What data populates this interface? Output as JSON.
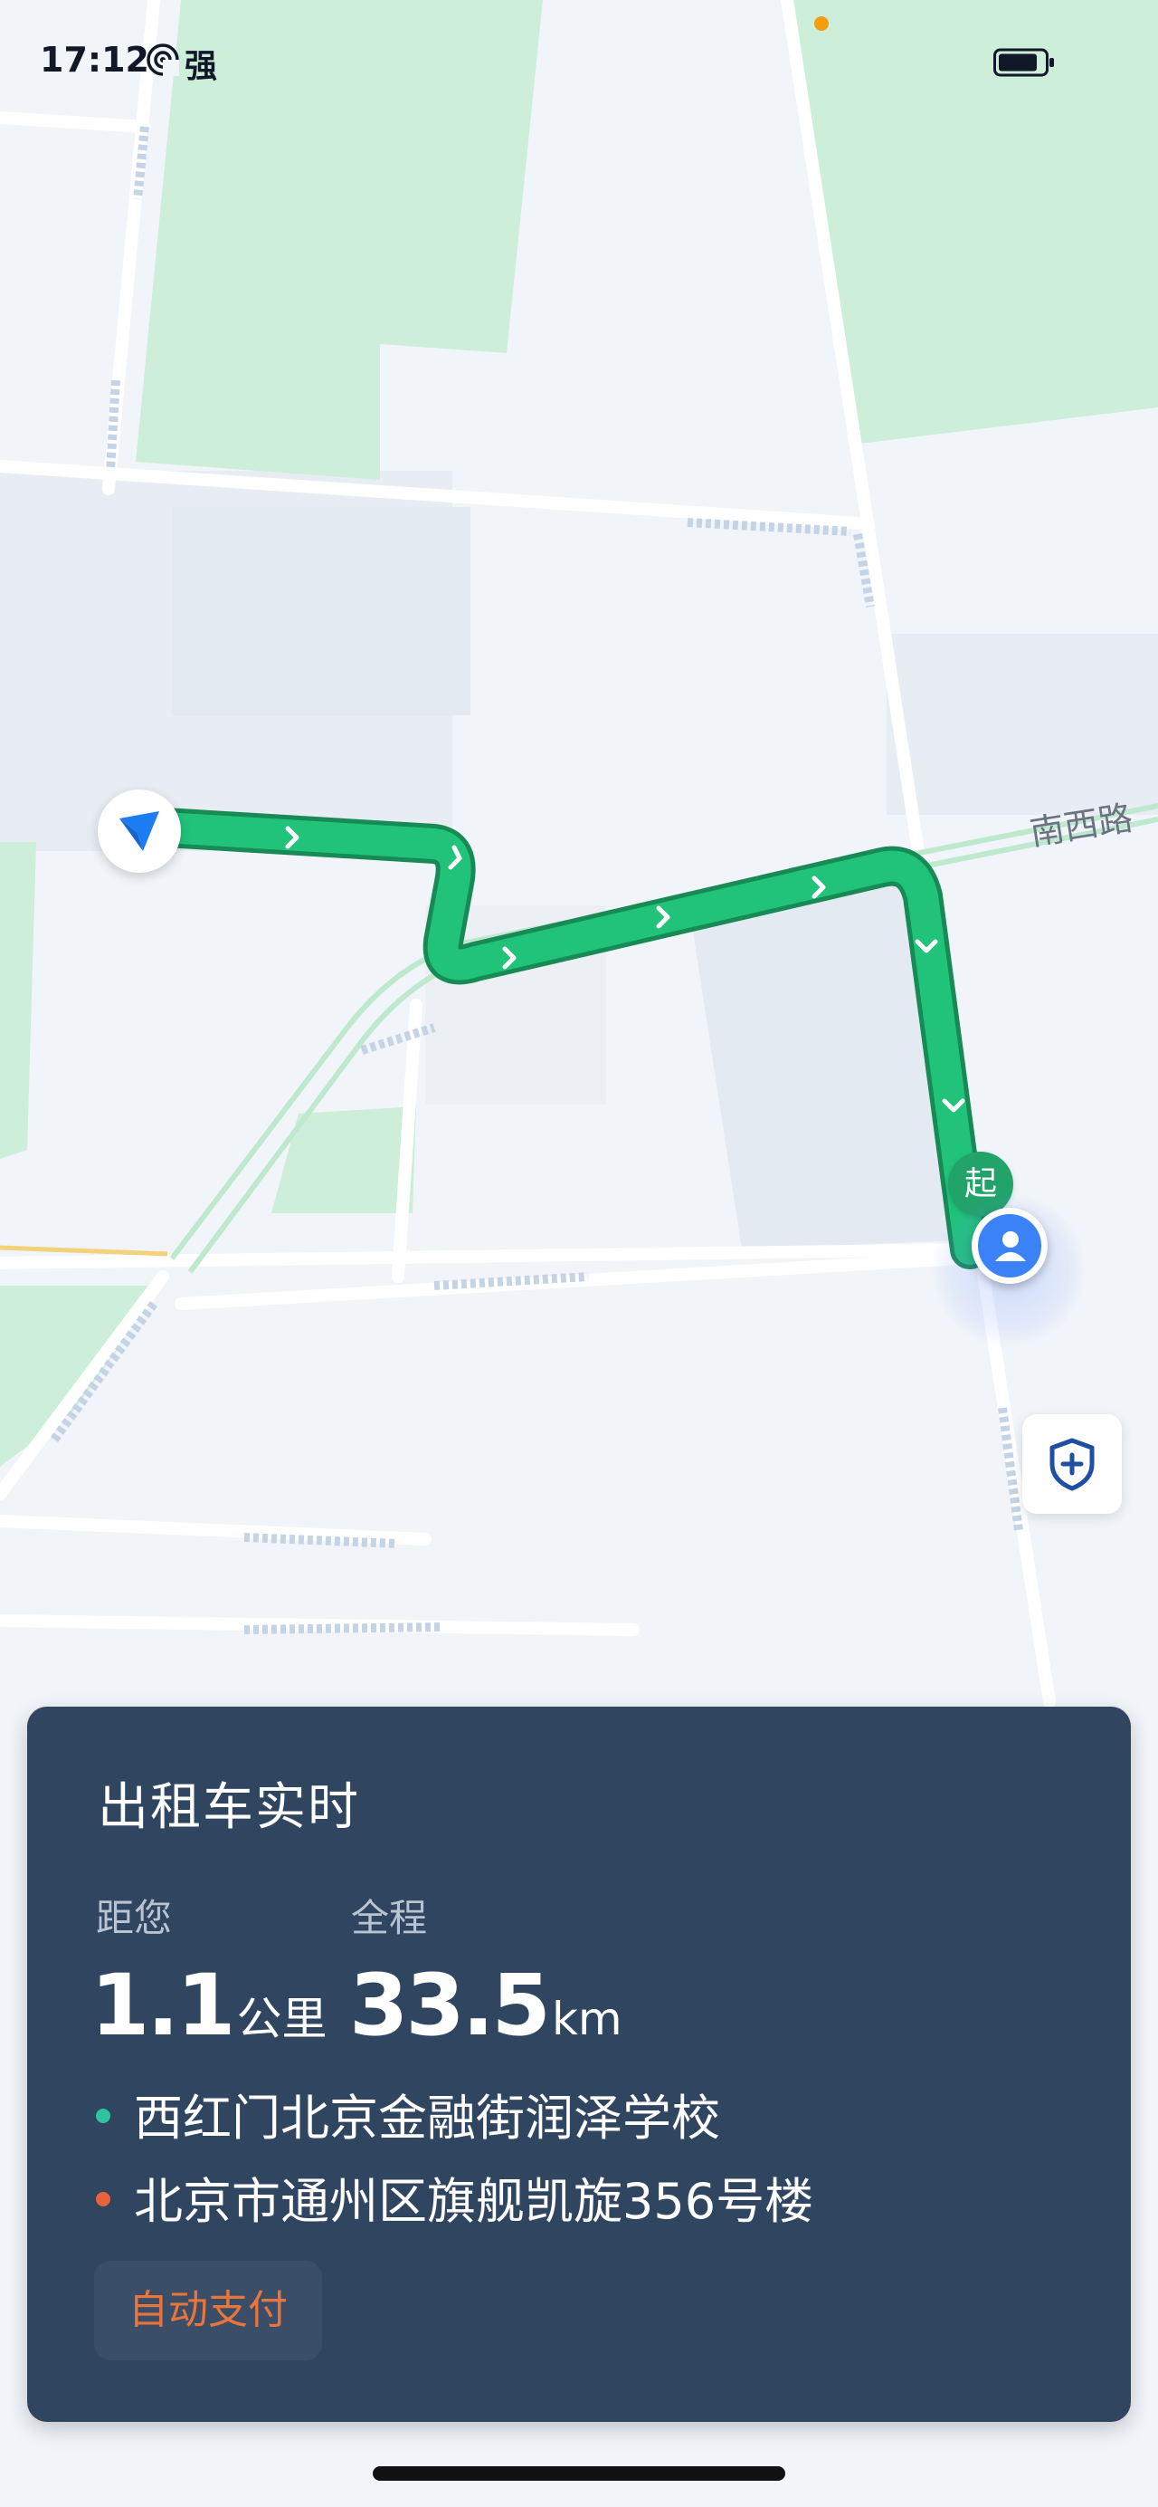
{
  "status_bar": {
    "time": "17:12",
    "signal_label": "强",
    "signal_icon": "hotspot-icon",
    "battery_icon": "battery-icon"
  },
  "map": {
    "road_label": "南西路",
    "start_badge": "起",
    "icons": {
      "navigation_marker": "navigation-arrow-icon",
      "user_marker": "user-avatar-icon",
      "safety_button": "shield-plus-icon"
    },
    "colors": {
      "route": "#21c27a",
      "route_outline": "#178a56",
      "green_area": "#cdeed8",
      "nav_arrow": "#1d7cf2"
    }
  },
  "trip_card": {
    "title": "出租车实时",
    "distance_label": "距您",
    "distance_value": "1.1",
    "distance_unit": "公里",
    "total_label": "全程",
    "total_value": "33.5",
    "total_unit": "km",
    "from_address": "西红门北京金融街润泽学校",
    "to_address": "北京市通州区旗舰凯旋356号楼",
    "payment_label": "自动支付",
    "colors": {
      "card_bg": "#2f4560",
      "from_dot": "#2ec4a0",
      "to_dot": "#e8623c",
      "payment_text": "#e9753d"
    }
  }
}
